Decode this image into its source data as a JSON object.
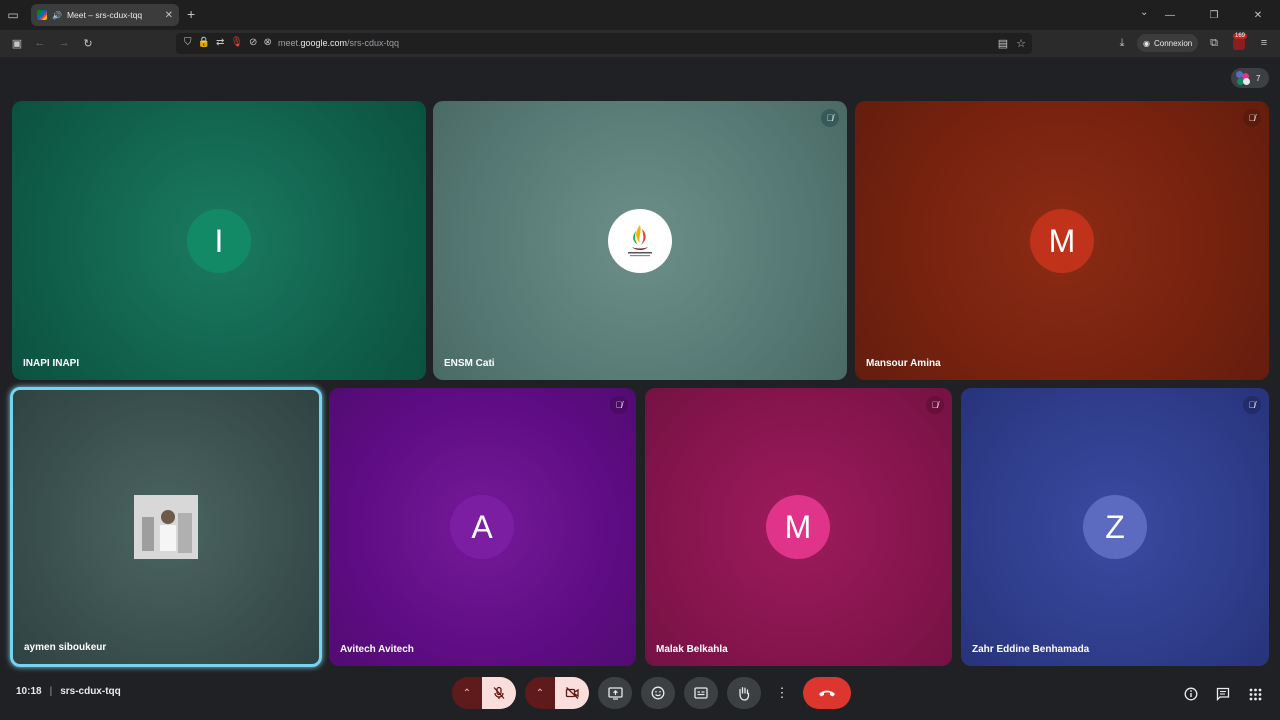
{
  "browser": {
    "tab_title": "Meet – srs-cdux-tqq",
    "url_domain_prefix": "meet.",
    "url_domain": "google.com",
    "url_path": "/srs-cdux-tqq",
    "connexion_label": "Connexion",
    "extension_badge": "169"
  },
  "meet": {
    "participants_count": "7",
    "time": "10:18",
    "meeting_code": "srs-cdux-tqq",
    "tiles": [
      {
        "name": "INAPI INAPI",
        "initial": "I",
        "avatar_color": "#128a66",
        "muted": false
      },
      {
        "name": "ENSM Cati",
        "initial": "",
        "avatar_type": "logo",
        "muted": true
      },
      {
        "name": "Mansour Amina",
        "initial": "M",
        "avatar_color": "#c0331a",
        "muted": true
      },
      {
        "name": "aymen siboukeur",
        "initial": "",
        "avatar_type": "photo",
        "muted": false,
        "active_speaker": true
      },
      {
        "name": "Avitech Avitech",
        "initial": "A",
        "avatar_color": "#7b1ea2",
        "muted": true
      },
      {
        "name": "Malak Belkahla",
        "initial": "M",
        "avatar_color": "#e0338a",
        "muted": true
      },
      {
        "name": "Zahr Eddine Benhamada",
        "initial": "Z",
        "avatar_color": "#5c6bc0",
        "muted": true
      }
    ]
  }
}
